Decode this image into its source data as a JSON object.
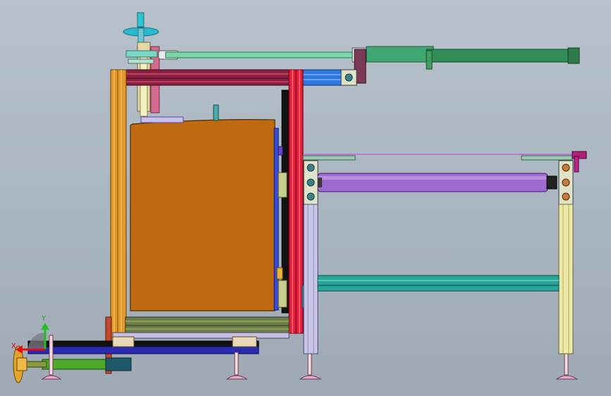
{
  "viewport": {
    "background_top": "#b7c2cc",
    "background_bottom": "#9ea9b4"
  },
  "triad": {
    "y_label": "Y",
    "x_label": "X",
    "y_color": "#22c022",
    "x_color": "#e01010"
  },
  "colors": {
    "frame_orange": "#e39a2c",
    "frame_red": "#e0203a",
    "frame_maroon": "#8a1f3f",
    "tank_brown": "#bf6a10",
    "roller_purple": "#a06bd0",
    "cylinder_green": "#2f8e57",
    "leg_cream": "#eee9a8",
    "leg_lavender": "#c9c6e8",
    "rail_teal": "#2aa59a",
    "base_navy": "#2a2ab0",
    "handwheel_cyan": "#29b8d0"
  }
}
